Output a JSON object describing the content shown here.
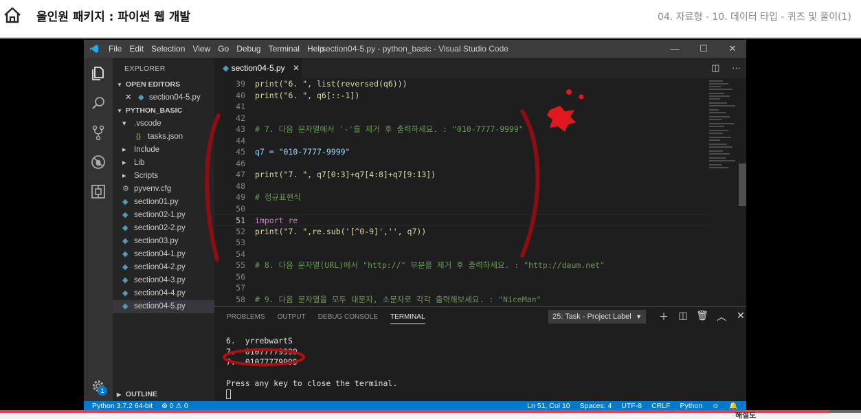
{
  "header": {
    "course_title": "올인원 패키지 : 파이썬 웹 개발",
    "lesson": "04. 자료형 - 10. 데이터 타입 - 퀴즈 및 풀이(1)"
  },
  "window": {
    "title": "section04-5.py - python_basic - Visual Studio Code",
    "menu": [
      "File",
      "Edit",
      "Selection",
      "View",
      "Go",
      "Debug",
      "Terminal",
      "Help"
    ],
    "controls": [
      "—",
      "☐",
      "✕"
    ]
  },
  "sidebar": {
    "header": "EXPLORER",
    "open_editors": "OPEN EDITORS",
    "open_file": "section04-5.py",
    "project": "PYTHON_BASIC",
    "items": [
      {
        "label": ".vscode",
        "kind": "folder-open"
      },
      {
        "label": "tasks.json",
        "kind": "json"
      },
      {
        "label": "Include",
        "kind": "folder"
      },
      {
        "label": "Lib",
        "kind": "folder"
      },
      {
        "label": "Scripts",
        "kind": "folder"
      },
      {
        "label": "pyvenv.cfg",
        "kind": "cfg"
      },
      {
        "label": "section01.py",
        "kind": "py"
      },
      {
        "label": "section02-1.py",
        "kind": "py"
      },
      {
        "label": "section02-2.py",
        "kind": "py"
      },
      {
        "label": "section03.py",
        "kind": "py"
      },
      {
        "label": "section04-1.py",
        "kind": "py"
      },
      {
        "label": "section04-2.py",
        "kind": "py"
      },
      {
        "label": "section04-3.py",
        "kind": "py"
      },
      {
        "label": "section04-4.py",
        "kind": "py"
      },
      {
        "label": "section04-5.py",
        "kind": "py",
        "selected": true
      }
    ],
    "outline": "OUTLINE",
    "gear_badge": "1"
  },
  "editor": {
    "tab_label": "section04-5.py",
    "lines": [
      {
        "no": "39",
        "text": "print(\"6. \", list(reversed(q6)))"
      },
      {
        "no": "40",
        "text": "print(\"6. \", q6[::-1])"
      },
      {
        "no": "41",
        "text": ""
      },
      {
        "no": "42",
        "text": ""
      },
      {
        "no": "43",
        "text": "# 7. 다음 문자열에서 '-'를 제거 후 출력하세요. : \"010-7777-9999\""
      },
      {
        "no": "44",
        "text": ""
      },
      {
        "no": "45",
        "text": "q7 = \"010-7777-9999\""
      },
      {
        "no": "46",
        "text": ""
      },
      {
        "no": "47",
        "text": "print(\"7. \", q7[0:3]+q7[4:8]+q7[9:13])"
      },
      {
        "no": "48",
        "text": ""
      },
      {
        "no": "49",
        "text": "# 정규표현식"
      },
      {
        "no": "50",
        "text": ""
      },
      {
        "no": "51",
        "text": "import re"
      },
      {
        "no": "52",
        "text": "print(\"7. \",re.sub('[^0-9]','', q7))"
      },
      {
        "no": "53",
        "text": ""
      },
      {
        "no": "54",
        "text": ""
      },
      {
        "no": "55",
        "text": "# 8. 다음 문자열(URL)에서 \"http://\" 부분을 제거 후 출력하세요. : \"http://daum.net\""
      },
      {
        "no": "56",
        "text": ""
      },
      {
        "no": "57",
        "text": ""
      },
      {
        "no": "58",
        "text": "# 9. 다음 문자열을 모두 대문자, 소문자로 각각 출력해보세요. : \"NiceMan\""
      }
    ],
    "current_line": "51"
  },
  "panel": {
    "tabs": [
      "PROBLEMS",
      "OUTPUT",
      "DEBUG CONSOLE",
      "TERMINAL"
    ],
    "active_tab": "TERMINAL",
    "terminal_select": "25: Task - Project Label",
    "terminal_lines": [
      "6.  yrrebwartS",
      "7.  01077779999",
      "7.  01077779999",
      "",
      "Press any key to close the terminal."
    ]
  },
  "statusbar": {
    "left": "Python 3.7.2 64-bit",
    "problems": "⊗ 0  ⚠ 0",
    "ln_col": "Ln 51, Col 10",
    "spaces": "Spaces: 4",
    "encoding": "UTF-8",
    "eol": "CRLF",
    "language": "Python"
  },
  "video": {
    "progress_fraction": 0.963,
    "bottom_label": "해설도"
  },
  "colors": {
    "accent": "#007acc",
    "progress": "#e53e4d",
    "annotation": "#e0191e"
  }
}
